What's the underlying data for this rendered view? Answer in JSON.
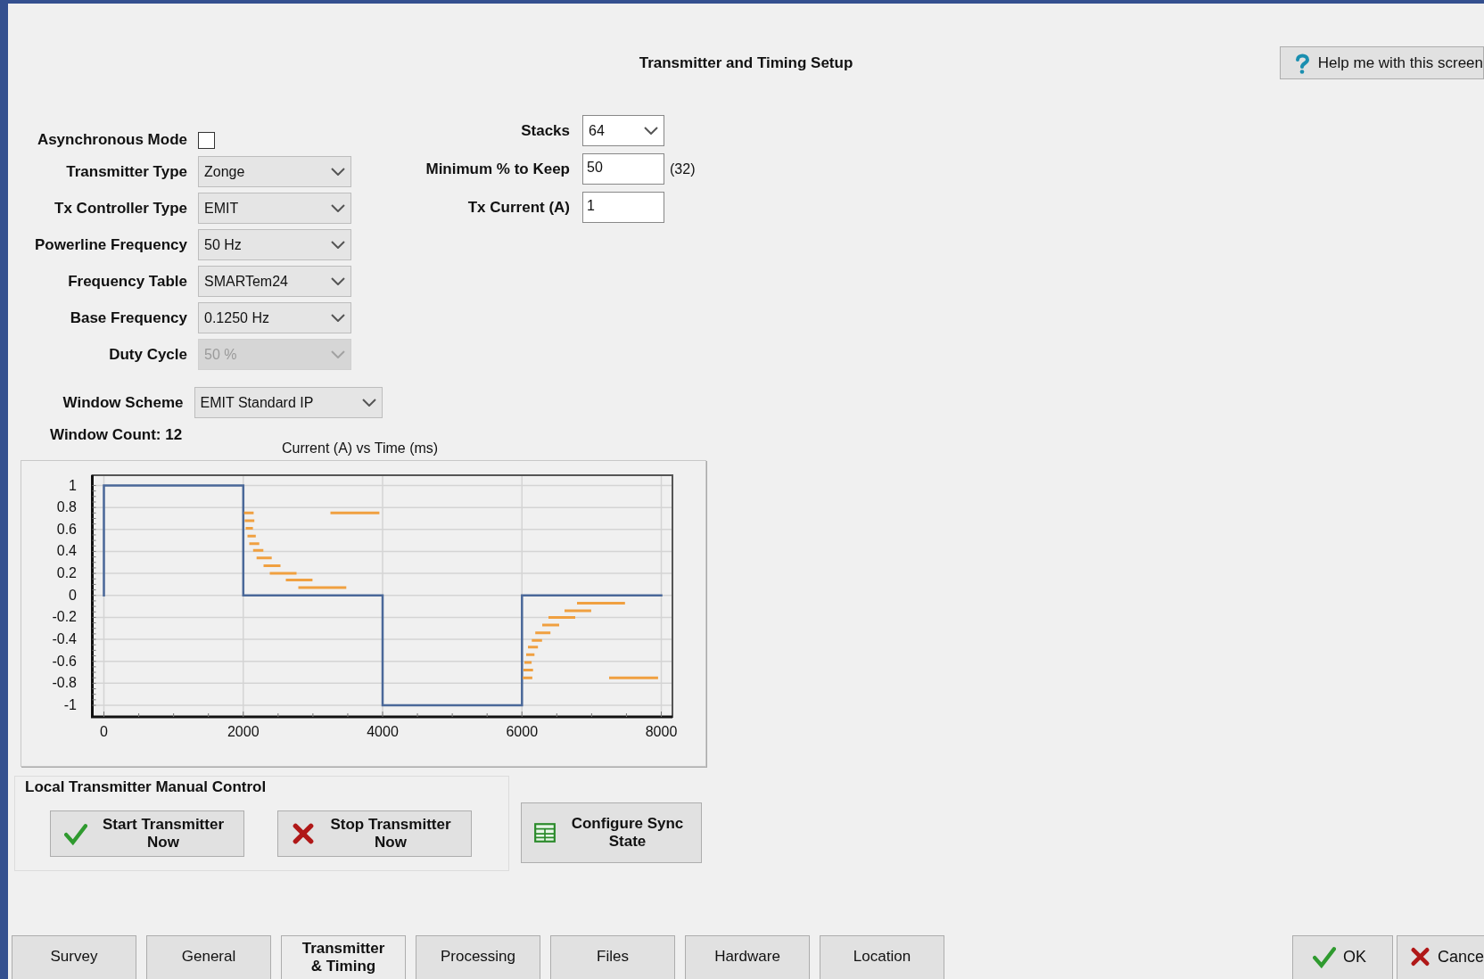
{
  "title": "Transmitter and Timing Setup",
  "help_button": {
    "label": "Help me with this screen"
  },
  "left_fields": [
    {
      "kind": "checkbox",
      "label": "Asynchronous Mode",
      "checked": false
    },
    {
      "kind": "select",
      "label": "Transmitter Type",
      "value": "Zonge",
      "disabled": false
    },
    {
      "kind": "select",
      "label": "Tx Controller Type",
      "value": "EMIT",
      "disabled": false
    },
    {
      "kind": "select",
      "label": "Powerline Frequency",
      "value": "50 Hz",
      "disabled": false
    },
    {
      "kind": "select",
      "label": "Frequency Table",
      "value": "SMARTem24",
      "disabled": false
    },
    {
      "kind": "select",
      "label": "Base Frequency",
      "value": "0.1250 Hz",
      "disabled": false
    },
    {
      "kind": "select",
      "label": "Duty Cycle",
      "value": "50 %",
      "disabled": true
    }
  ],
  "right_fields": [
    {
      "kind": "select",
      "label": "Stacks",
      "value": "64"
    },
    {
      "kind": "input",
      "label": "Minimum % to Keep",
      "value": "50",
      "note": "(32)"
    },
    {
      "kind": "input",
      "label": "Tx Current (A)",
      "value": "1"
    }
  ],
  "window_scheme": {
    "label": "Window Scheme",
    "value": "EMIT Standard IP"
  },
  "window_count": "Window Count: 12",
  "chart": {
    "chart_data": {
      "type": "line",
      "title": "Current (A) vs Time (ms)",
      "grid": true,
      "xlim": [
        0,
        8000
      ],
      "ylim": [
        -1,
        1
      ],
      "xticks": [
        0,
        2000,
        4000,
        6000,
        8000
      ],
      "yticks": [
        -1,
        -0.8,
        -0.6,
        -0.4,
        -0.2,
        0,
        0.2,
        0.4,
        0.6,
        0.8,
        1
      ],
      "series": [
        {
          "color": "#4a6899",
          "x": [
            0,
            0,
            2000,
            2000,
            4000,
            4000,
            6000,
            6000,
            8000
          ],
          "values": [
            0,
            1,
            1,
            0,
            0,
            -1,
            -1,
            0,
            0
          ]
        },
        {
          "color": "#f0a040",
          "x": [
            2030,
            2130,
            null,
            2040,
            2140,
            null,
            2055,
            2120,
            null,
            2080,
            2160,
            null,
            2105,
            2210,
            null,
            2160,
            2270,
            null,
            2210,
            2390,
            null,
            2310,
            2515,
            null,
            2400,
            2745,
            null,
            2630,
            2975,
            null,
            2810,
            3460,
            null,
            3270,
            3935,
            null,
            6030,
            6130,
            null,
            6040,
            6140,
            null,
            6055,
            6120,
            null,
            6080,
            6160,
            null,
            6105,
            6210,
            null,
            6160,
            6270,
            null,
            6210,
            6390,
            null,
            6310,
            6515,
            null,
            6400,
            6745,
            null,
            6630,
            6975,
            null,
            6810,
            7460,
            null,
            7270,
            7935
          ],
          "values": [
            0.75,
            0.75,
            null,
            0.68,
            0.68,
            null,
            0.61,
            0.61,
            null,
            0.54,
            0.54,
            null,
            0.47,
            0.47,
            null,
            0.41,
            0.41,
            null,
            0.34,
            0.34,
            null,
            0.27,
            0.27,
            null,
            0.2,
            0.2,
            null,
            0.14,
            0.14,
            null,
            0.07,
            0.07,
            null,
            0.75,
            0.75,
            null,
            -0.75,
            -0.75,
            null,
            -0.68,
            -0.68,
            null,
            -0.61,
            -0.61,
            null,
            -0.54,
            -0.54,
            null,
            -0.47,
            -0.47,
            null,
            -0.41,
            -0.41,
            null,
            -0.34,
            -0.34,
            null,
            -0.27,
            -0.27,
            null,
            -0.2,
            -0.2,
            null,
            -0.14,
            -0.14,
            null,
            -0.07,
            -0.07,
            null,
            -0.75,
            -0.75
          ]
        }
      ]
    }
  },
  "manual_control": {
    "title": "Local Transmitter Manual Control",
    "buttons": [
      {
        "kind": "start",
        "label": "Start Transmitter Now"
      },
      {
        "kind": "stop",
        "label": "Stop Transmitter Now"
      }
    ]
  },
  "configure_button": {
    "label": "Configure Sync State"
  },
  "tabs": [
    {
      "label": "Survey",
      "selected": false
    },
    {
      "label": "General",
      "selected": false
    },
    {
      "label": "Transmitter & Timing",
      "selected": true
    },
    {
      "label": "Processing",
      "selected": false
    },
    {
      "label": "Files",
      "selected": false
    },
    {
      "label": "Hardware",
      "selected": false
    },
    {
      "label": "Location",
      "selected": false
    }
  ],
  "ok_button": {
    "label": "OK"
  },
  "cancel_button": {
    "label": "Cance"
  }
}
